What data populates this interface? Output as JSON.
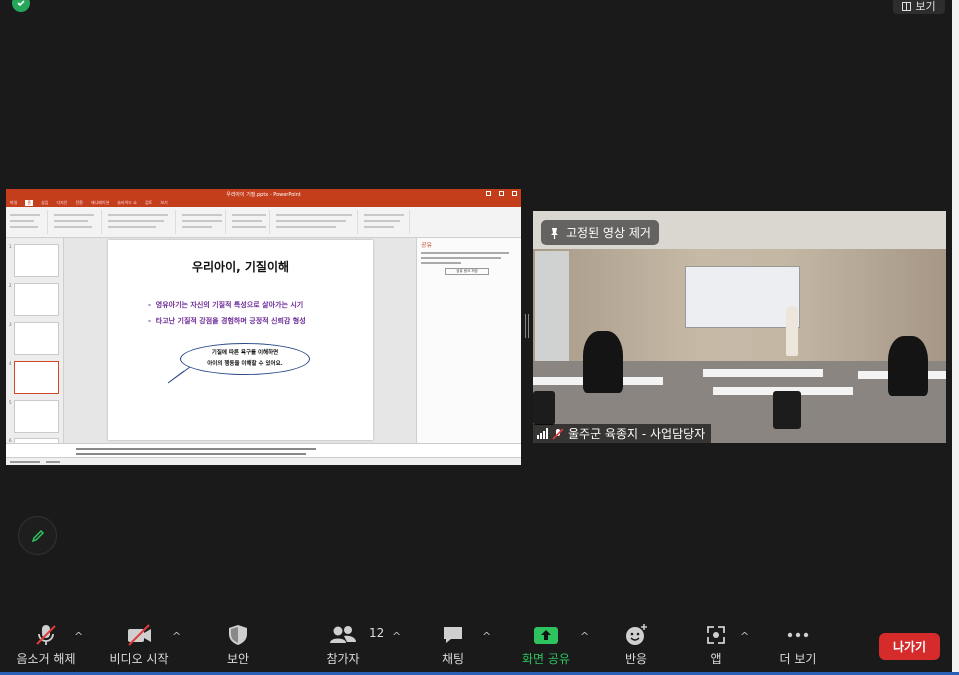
{
  "top": {
    "view_label": "보기"
  },
  "presentation": {
    "window_title": "우리아이 기질.pptx - PowerPoint",
    "tabs": [
      "파일",
      "홈",
      "삽입",
      "디자인",
      "전환",
      "애니메이션",
      "슬라이드 쇼",
      "검토",
      "보기"
    ],
    "slide_title": "우리아이, 기질이해",
    "bullets": [
      "영유아기는 자신의 기질적 특성으로 살아가는 시기",
      "타고난 기질적 강점을 경험하며 긍정적 신뢰감 형성"
    ],
    "bubble_lines": [
      "기질에 따른 욕구를 이해하면",
      "아이의 행동을 이해할 수 있어요."
    ],
    "share_pane_title": "공유",
    "share_pane_button": "공유 링크 저장"
  },
  "video": {
    "pin_label": "고정된 영상 제거",
    "participant_name": "울주군 육종지 - 사업담당자"
  },
  "toolbar": {
    "mute": "음소거 해제",
    "video": "비디오 시작",
    "security": "보안",
    "participants": "참가자",
    "participants_count": "12",
    "chat": "채팅",
    "share": "화면 공유",
    "reactions": "반응",
    "apps": "앱",
    "more": "더 보기",
    "leave": "나가기"
  },
  "colors": {
    "share_green": "#2ec35f",
    "leave_red": "#d52b2b",
    "ppt_accent": "#c43e1c"
  }
}
